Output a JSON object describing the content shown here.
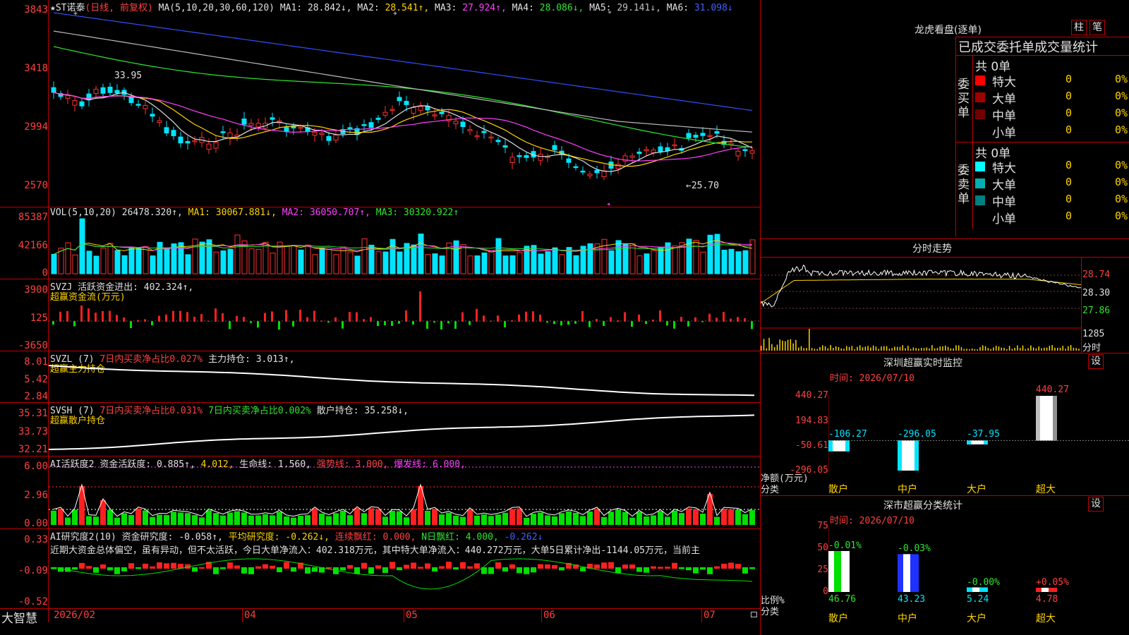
{
  "main": {
    "stock_name": "★ST诺泰",
    "period": "(日线, 前复权)",
    "ma_label": "MA(5,10,20,30,60,120)",
    "ma_values": [
      {
        "name": "MA1:",
        "value": "28.842↓,",
        "color": "#e0e0e0"
      },
      {
        "name": "MA2:",
        "value": "28.541↑,",
        "color": "#ffd400"
      },
      {
        "name": "MA3:",
        "value": "27.924↑,",
        "color": "#ff40ff"
      },
      {
        "name": "MA4:",
        "value": "28.086↓,",
        "color": "#2ee62e"
      },
      {
        "name": "MA5:",
        "value": "29.141↓,",
        "color": "#c0c0c0"
      },
      {
        "name": "MA6:",
        "value": "31.098↓",
        "color": "#4060ff"
      }
    ],
    "y_ticks": [
      "3843",
      "3418",
      "2994",
      "2570"
    ],
    "high_mark": "33.95",
    "low_mark": "←25.70"
  },
  "vol": {
    "label": "VOL(5,10,20)",
    "value": "26478.320↑,",
    "ma1": "MA1: 30067.881↓,",
    "ma2": "MA2: 36050.707↑,",
    "ma3": "MA3: 30320.922↑",
    "y_ticks": [
      "85387",
      "42166",
      "0"
    ]
  },
  "svzj": {
    "label": "SVZJ",
    "name": "活跃资金进出: 402.324↑,",
    "sub": "超赢资金流(万元)",
    "y_ticks": [
      "3900",
      "125",
      "-3650"
    ]
  },
  "svzl": {
    "label": "SVZL (7)",
    "p1": "7日内买卖净占比0.027%",
    "p2": "主力持仓: 3.013↑,",
    "sub": "超赢主力持仓",
    "y_ticks": [
      "8.01",
      "5.42",
      "2.84"
    ]
  },
  "svsh": {
    "label": "SVSH (7)",
    "p1": "7日内买卖净占比0.031%",
    "p2": "7日内买卖净占比0.002%",
    "p3": "散户持仓: 35.258↓,",
    "sub": "超赢散户持仓",
    "y_ticks": [
      "35.31",
      "33.73",
      "32.21"
    ]
  },
  "ai1": {
    "label": "AI活跃度2",
    "p1": "资金活跃度: 0.885↑,",
    "p2": "4.012,",
    "p3": "生命线: 1.560,",
    "p4": "强势线: 3.000,",
    "p5": "爆发线: 6.000,",
    "y_ticks": [
      "6.00",
      "2.96",
      "0.00"
    ]
  },
  "ai2": {
    "label": "AI研究度2(10)",
    "p1": "资金研究度: -0.058↑,",
    "p2": "平均研究度: -0.262↓,",
    "p3": "连续飘红: 0.000,",
    "p4": "N日飘红: 4.000,",
    "p5": "-0.262↓",
    "desc": "近期大资金总体偏空，虽有异动，但不太活跃，今日大单净流入：402.318万元，其中特大单净流入：440.272万元，大单5日累计净出-1144.05万元，当前主",
    "y_ticks": [
      "0.33",
      "-0.09",
      "-0.52"
    ]
  },
  "xaxis": {
    "logo": "大智慧",
    "labels": [
      "2026/02",
      "04",
      "05",
      "06",
      "07"
    ]
  },
  "right": {
    "lhb_title": "龙虎看盘(逐单)",
    "btn_zhu": "柱",
    "btn_bi": "笔",
    "stats_title": "已成交委托单成交量统计",
    "buy_label": "委买单",
    "sell_label": "委卖单",
    "buy_total": "共 0单",
    "sell_total": "共 0单",
    "buy_rows": [
      {
        "name": "特大",
        "count": "0",
        "pct": "0%",
        "color": "#ff0000"
      },
      {
        "name": "大单",
        "count": "0",
        "pct": "0%",
        "color": "#a00000"
      },
      {
        "name": "中单",
        "count": "0",
        "pct": "0%",
        "color": "#700000"
      },
      {
        "name": "小单",
        "count": "0",
        "pct": "0%",
        "color": ""
      }
    ],
    "sell_rows": [
      {
        "name": "特大",
        "count": "0",
        "pct": "0%",
        "color": "#00ffff"
      },
      {
        "name": "大单",
        "count": "0",
        "pct": "0%",
        "color": "#00b0b0"
      },
      {
        "name": "中单",
        "count": "0",
        "pct": "0%",
        "color": "#008080"
      },
      {
        "name": "小单",
        "count": "0",
        "pct": "0%",
        "color": ""
      }
    ],
    "intraday_title": "分时走势",
    "intraday_prices": [
      "28.74",
      "28.30",
      "27.86"
    ],
    "intraday_vol": "1285",
    "intraday_vol_label": "分时",
    "monitor_title": "深圳超赢实时监控",
    "monitor_btn": "设",
    "monitor_time": "时间: 2026/07/10",
    "monitor_ticks": [
      "440.27",
      "194.83",
      "-50.61",
      "-296.05"
    ],
    "monitor_bottom_label": "净额(万元)",
    "monitor_bottom_label2": "分类",
    "monitor_values": [
      {
        "cat": "散户",
        "value": "-106.27",
        "num": -106.27
      },
      {
        "cat": "中户",
        "value": "-296.05",
        "num": -296.05
      },
      {
        "cat": "大户",
        "value": "-37.95",
        "num": -37.95
      },
      {
        "cat": "超大",
        "value": "440.27",
        "num": 440.27
      }
    ],
    "class_title": "深市超赢分类统计",
    "class_btn": "设",
    "class_time": "时间: 2026/07/10",
    "class_ticks": [
      "75",
      "50",
      "25",
      "0"
    ],
    "class_bottom_label": "比例%",
    "class_bottom_label2": "分类",
    "class_values": [
      {
        "cat": "散户",
        "value": "46.76",
        "change": "-0.01%",
        "num": 46.76
      },
      {
        "cat": "中户",
        "value": "43.23",
        "change": "-0.03%",
        "num": 43.23
      },
      {
        "cat": "大户",
        "value": "5.24",
        "change": "-0.00%",
        "num": 5.24
      },
      {
        "cat": "超大",
        "value": "4.78",
        "change": "+0.05%",
        "num": 4.78
      }
    ]
  }
}
